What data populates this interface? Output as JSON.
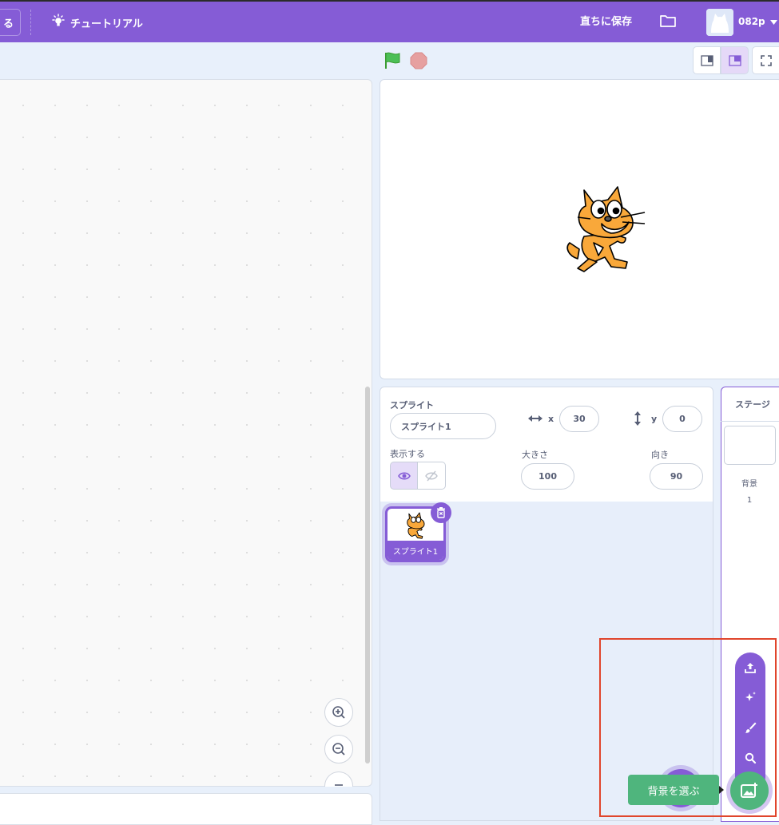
{
  "menubar": {
    "partial_button_label": "る",
    "tutorial_label": "チュートリアル",
    "save_now_label": "直ちに保存",
    "username": "082p"
  },
  "sprite_info": {
    "sprite_label": "スプライト",
    "sprite_name": "スプライト1",
    "x_label": "x",
    "x_value": "30",
    "y_label": "y",
    "y_value": "0",
    "show_label": "表示する",
    "size_label": "大きさ",
    "size_value": "100",
    "direction_label": "向き",
    "direction_value": "90"
  },
  "sprite_list": {
    "items": [
      {
        "name": "スプライト1",
        "selected": true
      }
    ]
  },
  "stage_pane": {
    "title": "ステージ",
    "backdrop_label": "背景",
    "backdrop_count": "1"
  },
  "backdrop_menu": {
    "tooltip": "背景を選ぶ",
    "items": [
      "upload-icon",
      "surprise-icon",
      "paint-icon",
      "search-icon"
    ]
  },
  "colors": {
    "accent": "#855cd6",
    "green": "#4fb57d",
    "highlight": "#e0452c"
  }
}
